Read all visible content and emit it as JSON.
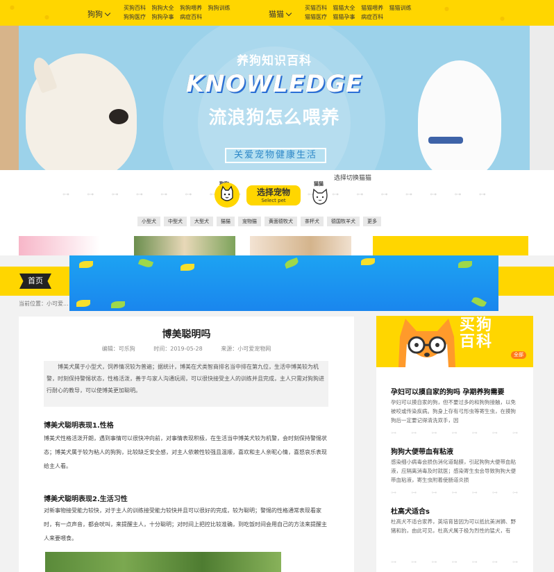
{
  "topnav": {
    "dog_label": "狗狗",
    "dog_links": [
      [
        "买狗百科",
        "狗狗大全",
        "狗狗喂养",
        "狗狗训练"
      ],
      [
        "狗狗医疗",
        "狗狗孕事",
        "病症百科"
      ]
    ],
    "cat_label": "猫猫",
    "cat_links": [
      [
        "买猫百科",
        "猫猫大全",
        "猫猫喂养",
        "猫猫训练"
      ],
      [
        "猫猫医疗",
        "猫猫孕事",
        "病症百科"
      ]
    ]
  },
  "banner": {
    "kicker": "养狗知识百科",
    "big": "KNOWLEDGE",
    "title": "流浪狗怎么喂养",
    "tag": "关爱宠物健康生活"
  },
  "selector": {
    "dog_label": "狗狗",
    "select_title": "选择宠物",
    "select_sub": "Select pet",
    "cat_label": "猫猫",
    "hint": "选择切换猫猫",
    "tags": [
      "小型犬",
      "中型犬",
      "大型犬",
      "猫猫",
      "宠物猫",
      "黄面德牧犬",
      "茶杯犬",
      "德国牧羊犬",
      "更多"
    ]
  },
  "nav": {
    "home": "首页",
    "crumb": "当前位置：小可爱..."
  },
  "article": {
    "title": "博美聪明吗",
    "editor": "编辑：可乐狗",
    "time": "时间：2019-05-28",
    "source": "来源：小可爱宠物网",
    "summary": "博美犬属于小型犬，饲养情况较为普遍；据统计，博美在犬类智商排名当中排在第九位，生活中博美较为机警，时刻保持警惕状态，性格活泼，善于与家人沟通玩闹，可以很快接受主人的训练并且完成，主人只需对狗狗进行耐心的教导，可以使博美更加聪明。",
    "h1": "博美犬聪明表现1.性格",
    "p1": "博美犬性格活泼开朗，遇到事情可以很快冲向前，对事情表现积极，在生活当中博美犬较为机警，会时刻保持警惕状态；博美犬属于较为粘人的狗狗，比较缺乏安全感，对主人依赖性较强且温顺，喜欢和主人亲昵心情，喜怒哀乐表现给主人看。",
    "h2": "博美犬聪明表现2.生活习性",
    "p2": "对新事物接受能力较快，对于主人的训练接受能力较快并且可以很好的完成，较为聪明；警惕的性格通常表现看家时，有一点声音，都会吠叫，来提醒主人，十分聪明；对时间上把控比较准确，到吃饭时间会用自己的方法来提醒主人来要喂食。"
  },
  "sidebar": {
    "banner_title_1": "买狗",
    "banner_title_2": "百科",
    "more": "全部",
    "items": [
      {
        "title": "孕妇可以摸自家的狗吗 孕期养狗需要",
        "desc": "孕妇可以摸自家的狗，但不要过多的和狗狗接触，以免被咬或传染疾病。狗身上存有弓形虫等寄生虫，在摸狗狗后一定要记得清洗双手，因"
      },
      {
        "title": "狗狗大便带血有粘液",
        "desc": "感染细小病毒会损伤消化道黏膜，引起狗狗大便带血粘液，应隔离消毒及时就医；感染寄生虫会导致狗狗大便带血粘液，寄生虫附着使肠道炎损"
      },
      {
        "title": "杜高犬适合s",
        "desc": "杜高犬不适合家养，英培育皆因为可以抵抗美洲狮、野猪和豹，由此可见，杜高犬属于极为烈性的猛犬，有着“狗"
      }
    ]
  },
  "colors": {
    "accent": "#ffd600",
    "sky": "#9cd2ea",
    "ad_blue": "#1a95f0"
  }
}
